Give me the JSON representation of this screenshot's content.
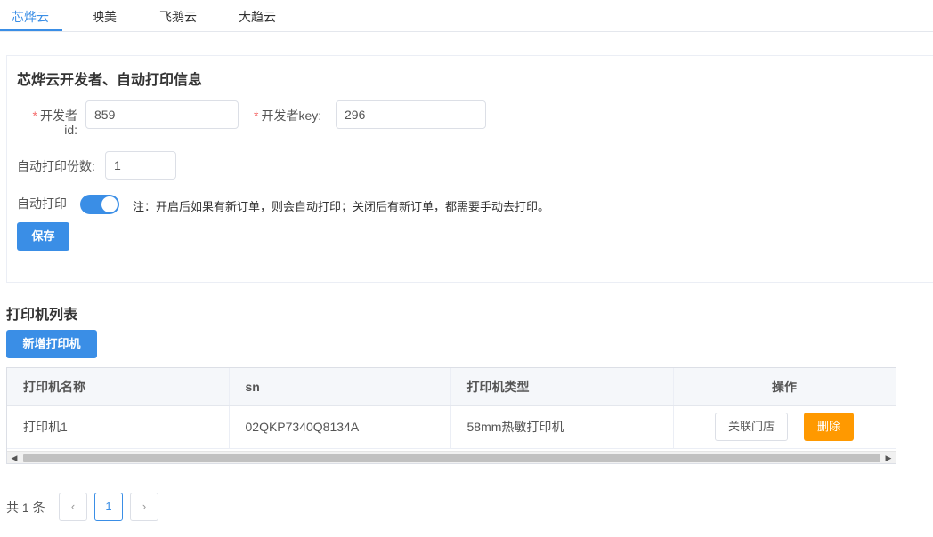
{
  "tabs": [
    "芯烨云",
    "映美",
    "飞鹅云",
    "大趋云"
  ],
  "dev_panel": {
    "title": "芯烨云开发者、自动打印信息",
    "dev_id_label_line1": "开发者",
    "dev_id_label_line2": "id:",
    "dev_id_value": "859",
    "dev_key_label": "开发者key:",
    "dev_key_value": "296",
    "copies_label": "自动打印份数:",
    "copies_value": "1",
    "auto_print_label": "自动打印",
    "auto_print_on": true,
    "auto_print_note": "注：开启后如果有新订单，则会自动打印；关闭后有新订单，都需要手动去打印。",
    "save_label": "保存",
    "required_mark": "*"
  },
  "printers": {
    "section_title": "打印机列表",
    "add_label": "新增打印机",
    "columns": [
      "打印机名称",
      "sn",
      "打印机类型",
      "操作"
    ],
    "rows": [
      {
        "name": "打印机1",
        "sn": "02QKP7340Q8134A",
        "type": "58mm热敏打印机",
        "link_label": "关联门店",
        "delete_label": "删除"
      }
    ]
  },
  "pagination": {
    "total_text": "共 1 条",
    "prev_icon": "‹",
    "current_page": "1",
    "next_icon": "›"
  },
  "colors": {
    "accent": "#3a8ee6",
    "warning": "#ff9900",
    "required": "#f56c6c"
  }
}
